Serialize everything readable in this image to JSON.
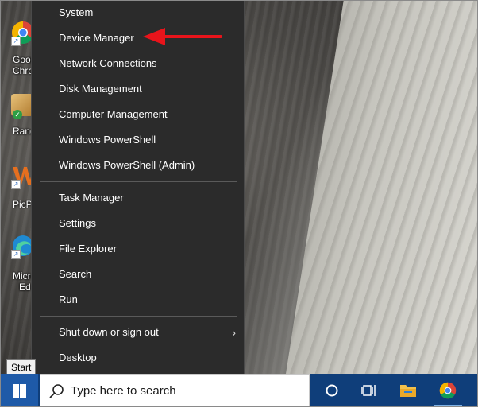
{
  "menu": {
    "group1": [
      {
        "label": "System"
      },
      {
        "label": "Device Manager"
      },
      {
        "label": "Network Connections"
      },
      {
        "label": "Disk Management"
      },
      {
        "label": "Computer Management"
      },
      {
        "label": "Windows PowerShell"
      },
      {
        "label": "Windows PowerShell (Admin)"
      }
    ],
    "group2": [
      {
        "label": "Task Manager"
      },
      {
        "label": "Settings"
      },
      {
        "label": "File Explorer"
      },
      {
        "label": "Search"
      },
      {
        "label": "Run"
      }
    ],
    "group3": [
      {
        "label": "Shut down or sign out",
        "has_submenu": true
      },
      {
        "label": "Desktop"
      }
    ]
  },
  "tooltip": "Start",
  "desktop_icons": [
    {
      "label_line1": "Goog",
      "label_line2": "Chro",
      "icon": "chrome-icon"
    },
    {
      "label_line1": "Rand",
      "icon": "app-icon"
    },
    {
      "label_line1": "PicP",
      "icon": "picpick-icon"
    },
    {
      "label_line1": "Micro",
      "label_line2": "Ed",
      "icon": "edge-icon"
    }
  ],
  "taskbar": {
    "search_placeholder": "Type here to search",
    "icons": [
      "windows-start-icon",
      "search-icon",
      "cortana-icon",
      "task-view-icon",
      "file-explorer-icon",
      "chrome-icon"
    ]
  },
  "annotation": {
    "color": "#e8141b",
    "points_to": "Device Manager"
  }
}
